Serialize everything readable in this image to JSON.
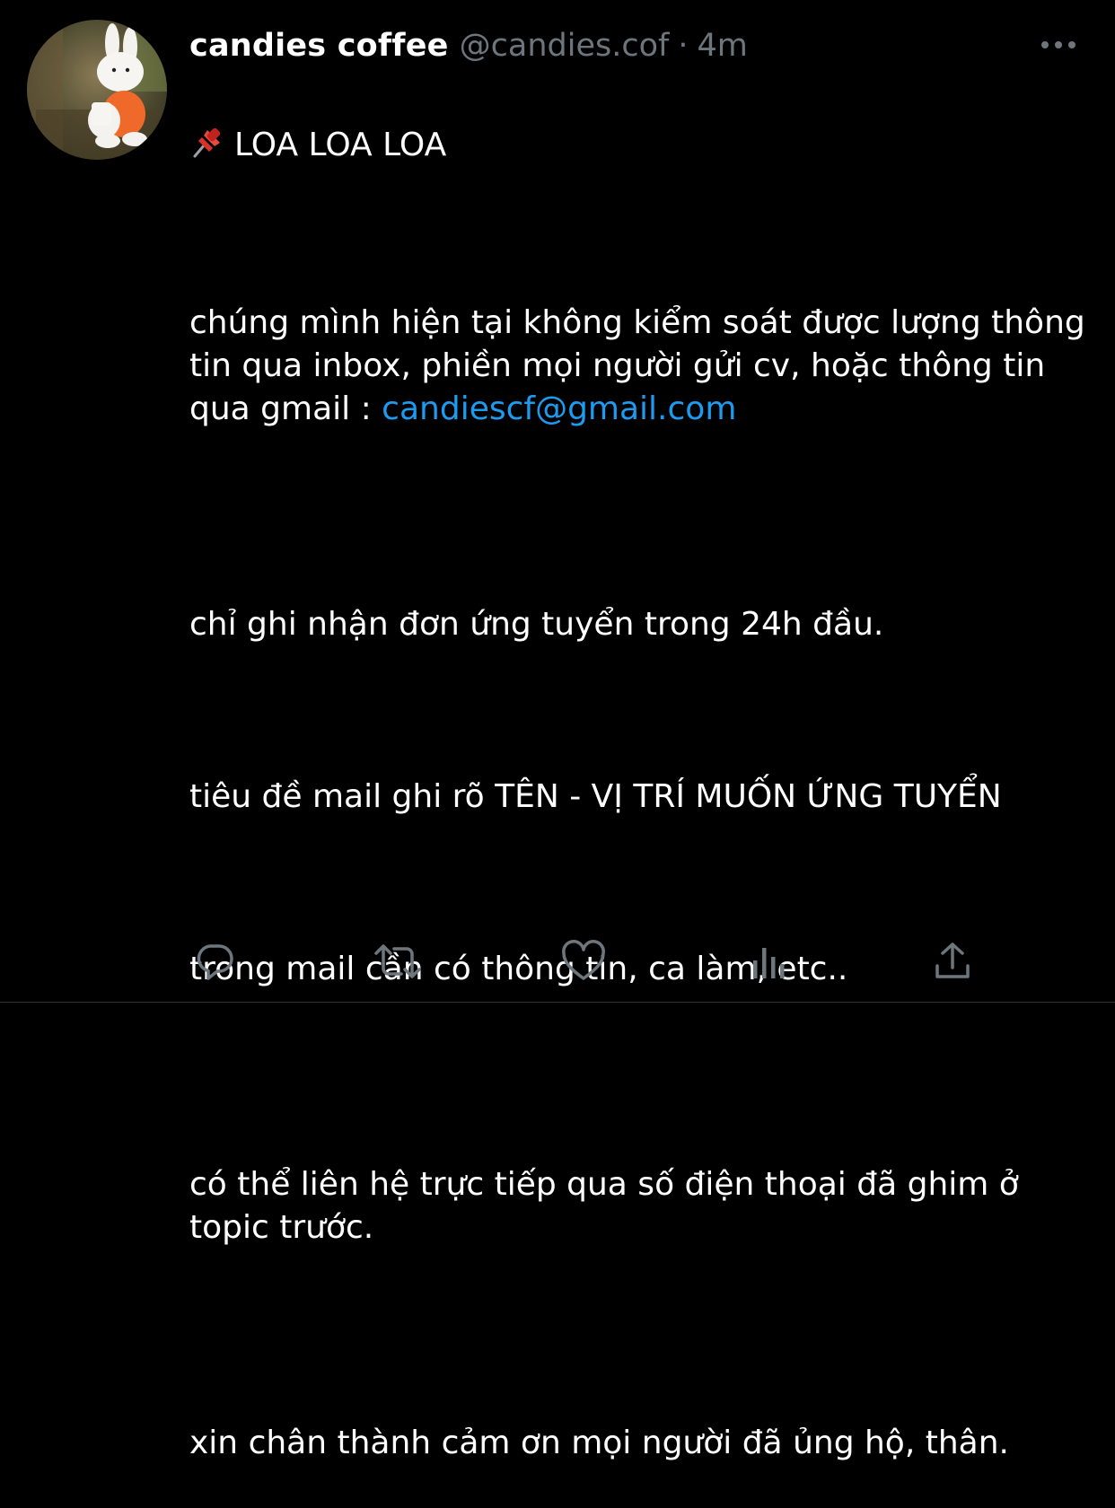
{
  "tweet": {
    "display_name": "candies coffee",
    "handle": "@candies.cof",
    "separator": "·",
    "time": "4m",
    "headline_emoji_icon": "pushpin-icon",
    "headline": "LOA LOA LOA",
    "para1_text": "chúng mình hiện tại không kiểm soát được lượng thông tin qua inbox, phiền mọi người gửi cv, hoặc thông tin qua gmail : ",
    "para1_link": "candiescf@gmail.com",
    "para2": "chỉ ghi nhận đơn ứng tuyển trong 24h đầu.",
    "para3": "tiêu đề mail ghi rõ TÊN - VỊ TRÍ MUỐN ỨNG TUYỂN",
    "para4": "trong mail cần có thông tin, ca làm, etc..",
    "para5": "có thể liên hệ trực tiếp qua số điện thoại đã ghim ở topic trước.",
    "para6": "xin chân thành cảm ơn mọi người đã ủng hộ, thân."
  },
  "actions": [
    {
      "icon": "reply-icon"
    },
    {
      "icon": "retweet-icon"
    },
    {
      "icon": "like-icon"
    },
    {
      "icon": "analytics-icon"
    },
    {
      "icon": "share-icon"
    }
  ],
  "colors": {
    "background": "#000000",
    "text": "#ffffff",
    "secondary": "#6e767d",
    "link": "#1d9bf0"
  }
}
